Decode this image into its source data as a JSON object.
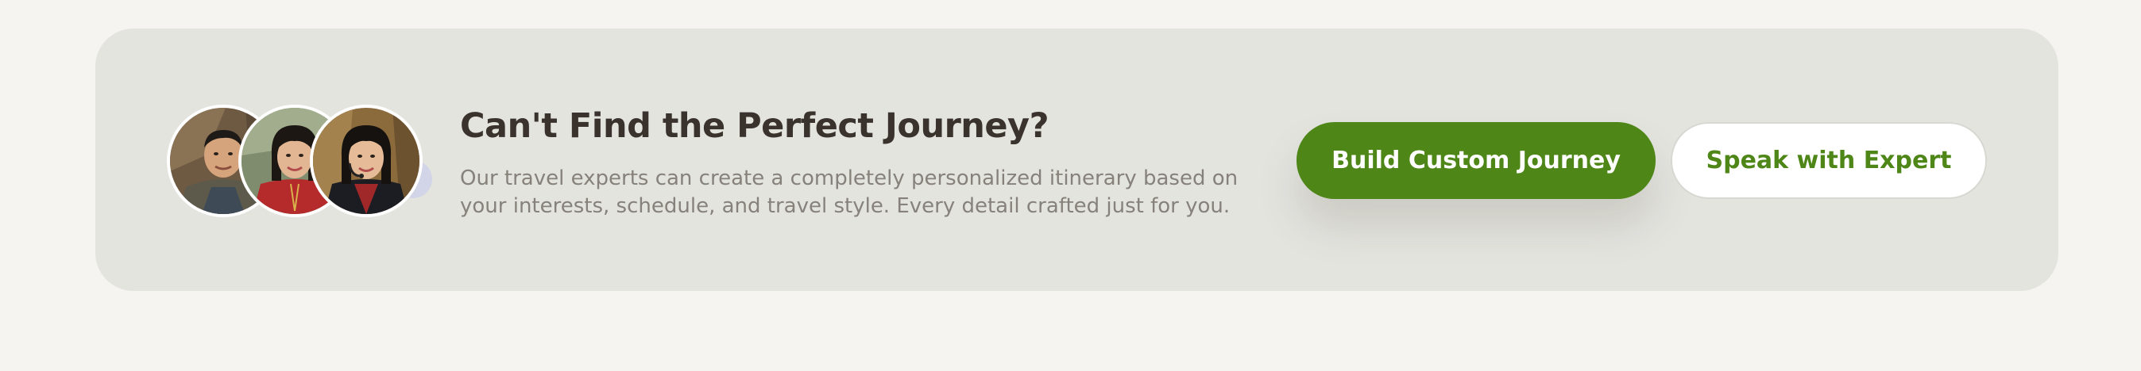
{
  "cta": {
    "title": "Can't Find the Perfect Journey?",
    "description": "Our travel experts can create a completely personalized itinerary based on your interests, schedule, and travel style. Every detail crafted just for you.",
    "primary_button": "Build Custom Journey",
    "secondary_button": "Speak with Expert"
  },
  "colors": {
    "page_background": "#f5f4f0",
    "card_background": "#e4e4df",
    "title": "#3a322c",
    "body_text": "#86817b",
    "brand_green": "#4e8618",
    "white": "#ffffff"
  },
  "avatars": [
    {
      "icon": "travel-expert-avatar-man"
    },
    {
      "icon": "travel-expert-avatar-woman"
    },
    {
      "icon": "travel-expert-avatar-woman-headset"
    }
  ]
}
